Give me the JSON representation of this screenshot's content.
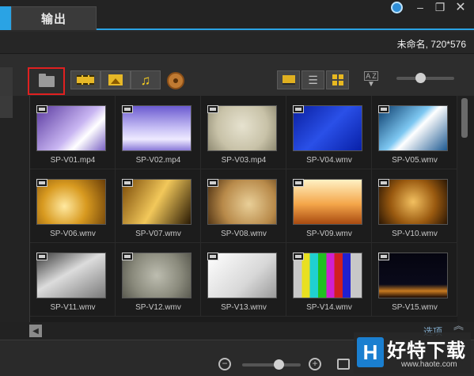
{
  "window": {
    "tab_label": "输出",
    "project_info": "未命名, 720*576",
    "controls": {
      "minimize": "–",
      "restore": "❐",
      "close": "✕"
    }
  },
  "toolbar": {
    "buttons": [
      "folder-icon",
      "video-filter-icon",
      "photo-filter-icon",
      "audio-filter-icon",
      "flash-animation-icon",
      "thumbnail-view-icon",
      "list-view-icon",
      "grid-view-icon",
      "sort-icon"
    ],
    "sort_label": "A Z"
  },
  "library": {
    "items": [
      {
        "name": "SP-V01.mp4",
        "bg": "linear-gradient(135deg,#5a3aa0,#c9b6f2 55%,#ffffff 70%,#7a62c4)"
      },
      {
        "name": "SP-V02.mp4",
        "bg": "linear-gradient(180deg,#6b5bd0,#c7bff5 50%,#eeeaff 75%,#8a7ad8)"
      },
      {
        "name": "SP-V03.mp4",
        "bg": "radial-gradient(circle at 50% 45%,#e6e2cf,#c8c2a8 60%,#8f8a72)"
      },
      {
        "name": "SP-V04.wmv",
        "bg": "linear-gradient(135deg,#0a1fa0,#2a50e8 50%,#0820a8)"
      },
      {
        "name": "SP-V05.wmv",
        "bg": "linear-gradient(135deg,#0a3a6a,#7ec8f2 45%,#ffffff 55%,#1e5a92)"
      },
      {
        "name": "SP-V06.wmv",
        "bg": "radial-gradient(circle at 40% 60%,#ffe9a0,#d89a20 45%,#6a3e08)"
      },
      {
        "name": "SP-V07.wmv",
        "bg": "linear-gradient(120deg,#7a4a08,#f2c85a 50%,#2a1a04)"
      },
      {
        "name": "SP-V08.wmv",
        "bg": "radial-gradient(circle at 60% 55%,#e9cf98,#b88a4a 55%,#4a2e10)"
      },
      {
        "name": "SP-V09.wmv",
        "bg": "linear-gradient(180deg,#fff1c4,#f4a64a 55%,#a84a10)"
      },
      {
        "name": "SP-V10.wmv",
        "bg": "radial-gradient(circle at 50% 50%,#f2c060,#9a5a10 55%,#2a1604)"
      },
      {
        "name": "SP-V11.wmv",
        "bg": "linear-gradient(150deg,#3a3a3a,#dcdcdc 45%,#7a7a7a)"
      },
      {
        "name": "SP-V12.wmv",
        "bg": "radial-gradient(circle at 50% 50%,#bdbdb0,#8a8a7c 60%,#5a5a50)"
      },
      {
        "name": "SP-V13.wmv",
        "bg": "linear-gradient(135deg,#ffffff,#d8d8d8 60%,#9a9a9a)"
      },
      {
        "name": "SP-V14.wmv",
        "bg": "linear-gradient(90deg,#c8c8c8 0 12%,#e8e020 12% 24%,#20d0d0 24% 36%,#20c020 36% 48%,#d020d0 48% 60%,#d02020 60% 72%,#2020d0 72% 84%,#c8c8c8 84%)"
      },
      {
        "name": "SP-V15.wmv",
        "bg": "linear-gradient(180deg,#050510,#0a0a1a 70%,#c87a20 85%,#1a0a04)"
      }
    ]
  },
  "bottom": {
    "options_label": "选项",
    "watermark_title": "好特下载",
    "watermark_url": "www.haote.com",
    "logo_letter": "H"
  }
}
